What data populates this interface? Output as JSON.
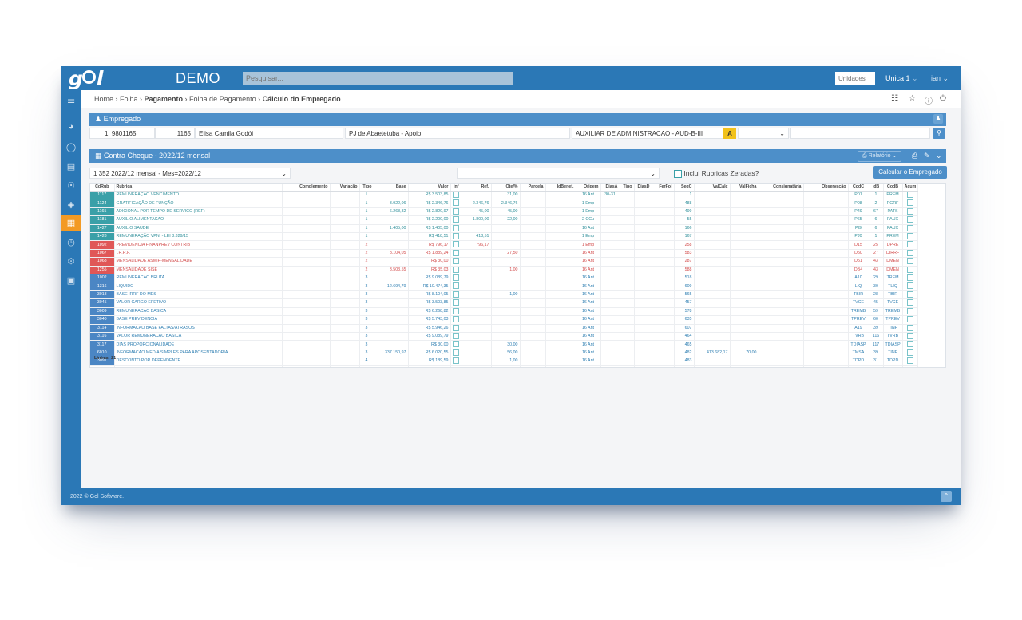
{
  "app": {
    "company": "DEMO",
    "search_placeholder": "Pesquisar...",
    "unit_placeholder": "Unidades",
    "unit_selected": "Unica 1",
    "user": "ian",
    "footer": "2022 © Gol Software."
  },
  "breadcrumb": [
    "Home",
    "Folha",
    "Pagamento",
    "Folha de Pagamento",
    "Cálculo do Empregado"
  ],
  "empregado": {
    "title": "Empregado",
    "seq": "1",
    "matricula": "9801165",
    "codigo": "1165",
    "nome": "Elisa Camila Godói",
    "lotacao": "PJ de Abaetetuba - Apoio",
    "cargo": "AUXILIAR DE ADMINISTRACAO - AUD-B-III",
    "situacao": "A"
  },
  "contracheque": {
    "title": "Contra Cheque - 2022/12 mensal",
    "relatorio_label": "Relatório",
    "select_value": "1 352 2022/12 mensal - Mes=2022/12",
    "zeradas_label": "Inclui Rubricas Zeradas?",
    "calc_button": "Calcular o Empregado",
    "linhas": "Linhas: 21",
    "columns": [
      "CdRub",
      "Rubrica",
      "Complemento",
      "Variação",
      "Tipo",
      "Base",
      "Valor",
      "Inf",
      "Ref.",
      "Qte/%",
      "Parcela",
      "IdBenef.",
      "Origem",
      "DiasA",
      "Tipo",
      "DiasD",
      "FerFol",
      "SeqC",
      "ValCalc",
      "ValFicha",
      "Consignatária",
      "Observação",
      "CodC",
      "IdB",
      "CodB",
      "Acum"
    ],
    "rows": [
      {
        "cod": "1117",
        "rub": "REMUNERAÇÃO VENCIMENTO",
        "tipo": "1",
        "base": "",
        "valor": "R$ 3.503,85",
        "ref": "",
        "qte": "31,00",
        "origem": "16 Ant",
        "diasA": "30-31",
        "seqc": "1",
        "valcalc": "",
        "valficha": "",
        "codc": "P01",
        "idb": "1",
        "codb": "PREM",
        "kind": "prov"
      },
      {
        "cod": "1124",
        "rub": "GRATIFICAÇÃO DE FUNÇÃO",
        "tipo": "1",
        "base": "3.922,06",
        "valor": "R$ 2.346,76",
        "ref": "2.346,76",
        "qte": "2.346,76",
        "origem": "1 Emp",
        "diasA": "",
        "seqc": "488",
        "valcalc": "",
        "valficha": "",
        "codc": "P08",
        "idb": "2",
        "codb": "PGRF",
        "kind": "prov"
      },
      {
        "cod": "1165",
        "rub": "ADICIONAL POR TEMPO DE SERVICO (REF)",
        "tipo": "1",
        "base": "6.268,82",
        "valor": "R$ 2.820,97",
        "ref": "45,00",
        "qte": "45,00",
        "origem": "1 Emp",
        "diasA": "",
        "seqc": "499",
        "valcalc": "",
        "valficha": "",
        "codc": "P49",
        "idb": "67",
        "codb": "PATS",
        "kind": "prov"
      },
      {
        "cod": "1181",
        "rub": "AUXILIO ALIMENTACAO",
        "tipo": "1",
        "base": "",
        "valor": "R$ 2.200,00",
        "ref": "1.800,00",
        "qte": "22,00",
        "origem": "2 CCu",
        "diasA": "",
        "seqc": "55",
        "valcalc": "",
        "valficha": "",
        "codc": "P65",
        "idb": "6",
        "codb": "PAUX",
        "kind": "prov"
      },
      {
        "cod": "1427",
        "rub": "AUXILIO SAUDE",
        "tipo": "1",
        "base": "1.405,00",
        "valor": "R$ 1.405,00",
        "ref": "",
        "qte": "",
        "origem": "16 Ant",
        "diasA": "",
        "seqc": "166",
        "valcalc": "",
        "valficha": "",
        "codc": "PI9",
        "idb": "6",
        "codb": "PAUX",
        "kind": "prov"
      },
      {
        "cod": "1428",
        "rub": "REMUNERAÇÃO VPNI - LEI 8.329/15",
        "tipo": "1",
        "base": "",
        "valor": "R$ 418,51",
        "ref": "418,51",
        "qte": "",
        "origem": "1 Emp",
        "diasA": "",
        "seqc": "167",
        "valcalc": "",
        "valficha": "",
        "codc": "PJ0",
        "idb": "1",
        "codb": "PREM",
        "kind": "prov"
      },
      {
        "cod": "1092",
        "rub": "PREVIDENCIA FINANPREV CONTRIB",
        "tipo": "2",
        "base": "",
        "valor": "R$ 796,17",
        "ref": "796,17",
        "qte": "",
        "origem": "1 Emp",
        "diasA": "",
        "seqc": "258",
        "valcalc": "",
        "valficha": "",
        "codc": "D15",
        "idb": "25",
        "codb": "DPRE",
        "kind": "red"
      },
      {
        "cod": "1067",
        "rub": "I.R.R.F.",
        "tipo": "2",
        "base": "8.104,05",
        "valor": "R$ 1.889,24",
        "ref": "",
        "qte": "27,50",
        "origem": "16 Ant",
        "diasA": "",
        "seqc": "583",
        "valcalc": "",
        "valficha": "",
        "codc": "D50",
        "idb": "27",
        "codb": "DIRRF",
        "kind": "red"
      },
      {
        "cod": "1068",
        "rub": "MENSALIDADE ASMIP-MENSALIDADE",
        "tipo": "2",
        "base": "",
        "valor": "R$ 30,00",
        "ref": "",
        "qte": "",
        "origem": "16 Ant",
        "diasA": "",
        "seqc": "287",
        "valcalc": "",
        "valficha": "",
        "codc": "D51",
        "idb": "43",
        "codb": "DMEN",
        "kind": "red"
      },
      {
        "cod": "1255",
        "rub": "MENSALIDADE SISE",
        "tipo": "2",
        "base": "3.503,55",
        "valor": "R$ 35,03",
        "ref": "",
        "qte": "1,00",
        "origem": "16 Ant",
        "diasA": "",
        "seqc": "588",
        "valcalc": "",
        "valficha": "",
        "codc": "DB4",
        "idb": "43",
        "codb": "DMEN",
        "kind": "red"
      },
      {
        "cod": "1002",
        "rub": "REMUNERACAO BRUTA",
        "tipo": "3",
        "base": "",
        "valor": "R$ 9.089,79",
        "ref": "",
        "qte": "",
        "origem": "16 Ant",
        "diasA": "",
        "seqc": "518",
        "valcalc": "",
        "valficha": "",
        "codc": "A10",
        "idb": "29",
        "codb": "TREM",
        "kind": "base"
      },
      {
        "cod": "1316",
        "rub": "LIQUIDO",
        "tipo": "3",
        "base": "12.694,79",
        "valor": "R$ 10.474,35",
        "ref": "",
        "qte": "",
        "origem": "16 Ant",
        "diasA": "",
        "seqc": "609",
        "valcalc": "",
        "valficha": "",
        "codc": "LIQ",
        "idb": "30",
        "codb": "TLIQ",
        "kind": "base"
      },
      {
        "cod": "3018",
        "rub": "BASE IRRF DO MES",
        "tipo": "3",
        "base": "",
        "valor": "R$ 8.104,05",
        "ref": "",
        "qte": "1,00",
        "origem": "16 Ant",
        "diasA": "",
        "seqc": "565",
        "valcalc": "",
        "valficha": "",
        "codc": "TBIR",
        "idb": "28",
        "codb": "TBIR",
        "kind": "base"
      },
      {
        "cod": "3045",
        "rub": "VALOR CARGO EFETIVO",
        "tipo": "3",
        "base": "",
        "valor": "R$ 3.503,85",
        "ref": "",
        "qte": "",
        "origem": "16 Ant",
        "diasA": "",
        "seqc": "457",
        "valcalc": "",
        "valficha": "",
        "codc": "TVCE",
        "idb": "45",
        "codb": "TVCE",
        "kind": "base"
      },
      {
        "cod": "3009",
        "rub": "REMUNERACAO BASICA",
        "tipo": "3",
        "base": "",
        "valor": "R$ 6.268,82",
        "ref": "",
        "qte": "",
        "origem": "16 Ant",
        "diasA": "",
        "seqc": "578",
        "valcalc": "",
        "valficha": "",
        "codc": "TREMB",
        "idb": "59",
        "codb": "TREMB",
        "kind": "base"
      },
      {
        "cod": "3040",
        "rub": "BASE PREVIDENCIA",
        "tipo": "3",
        "base": "",
        "valor": "R$ 5.743,03",
        "ref": "",
        "qte": "",
        "origem": "16 Ant",
        "diasA": "",
        "seqc": "635",
        "valcalc": "",
        "valficha": "",
        "codc": "TPREV",
        "idb": "60",
        "codb": "TPREV",
        "kind": "base"
      },
      {
        "cod": "3114",
        "rub": "INFORMACAO BASE FALTAS/ATRASOS",
        "tipo": "3",
        "base": "",
        "valor": "R$ 5.946,26",
        "ref": "",
        "qte": "",
        "origem": "16 Ant",
        "diasA": "",
        "seqc": "607",
        "valcalc": "",
        "valficha": "",
        "codc": "A19",
        "idb": "39",
        "codb": "TINF",
        "kind": "base"
      },
      {
        "cod": "3116",
        "rub": "VALOR REMUNERACAO BASICA",
        "tipo": "3",
        "base": "",
        "valor": "R$ 9.089,79",
        "ref": "",
        "qte": "",
        "origem": "16 Ant",
        "diasA": "",
        "seqc": "464",
        "valcalc": "",
        "valficha": "",
        "codc": "TVRB",
        "idb": "116",
        "codb": "TVRB",
        "kind": "base"
      },
      {
        "cod": "3117",
        "rub": "DIAS PROPORCIONALIDADE",
        "tipo": "3",
        "base": "",
        "valor": "R$ 30,00",
        "ref": "",
        "qte": "30,00",
        "origem": "16 Ant",
        "diasA": "",
        "seqc": "465",
        "valcalc": "",
        "valficha": "",
        "codc": "TDIASP",
        "idb": "117",
        "codb": "TDIASP",
        "kind": "base"
      },
      {
        "cod": "6010",
        "rub": "INFORMACAO MEDIA SIMPLES PARA APOSENTADORIA",
        "tipo": "3",
        "base": "337.150,97",
        "valor": "R$ 6.020,55",
        "ref": "",
        "qte": "56,00",
        "origem": "16 Ant",
        "diasA": "",
        "seqc": "482",
        "valcalc": "413.682,17",
        "valficha": "70,00",
        "codc": "TMSA",
        "idb": "39",
        "codb": "TINF",
        "kind": "base"
      },
      {
        "cod": "3091",
        "rub": "DESCONTO POR DEPENDENTE",
        "tipo": "4",
        "base": "",
        "valor": "R$ 189,59",
        "ref": "",
        "qte": "1,00",
        "origem": "16 Ant",
        "diasA": "",
        "seqc": "483",
        "valcalc": "",
        "valficha": "",
        "codc": "TDPD",
        "idb": "31",
        "codb": "TDPD",
        "kind": "base"
      }
    ]
  }
}
